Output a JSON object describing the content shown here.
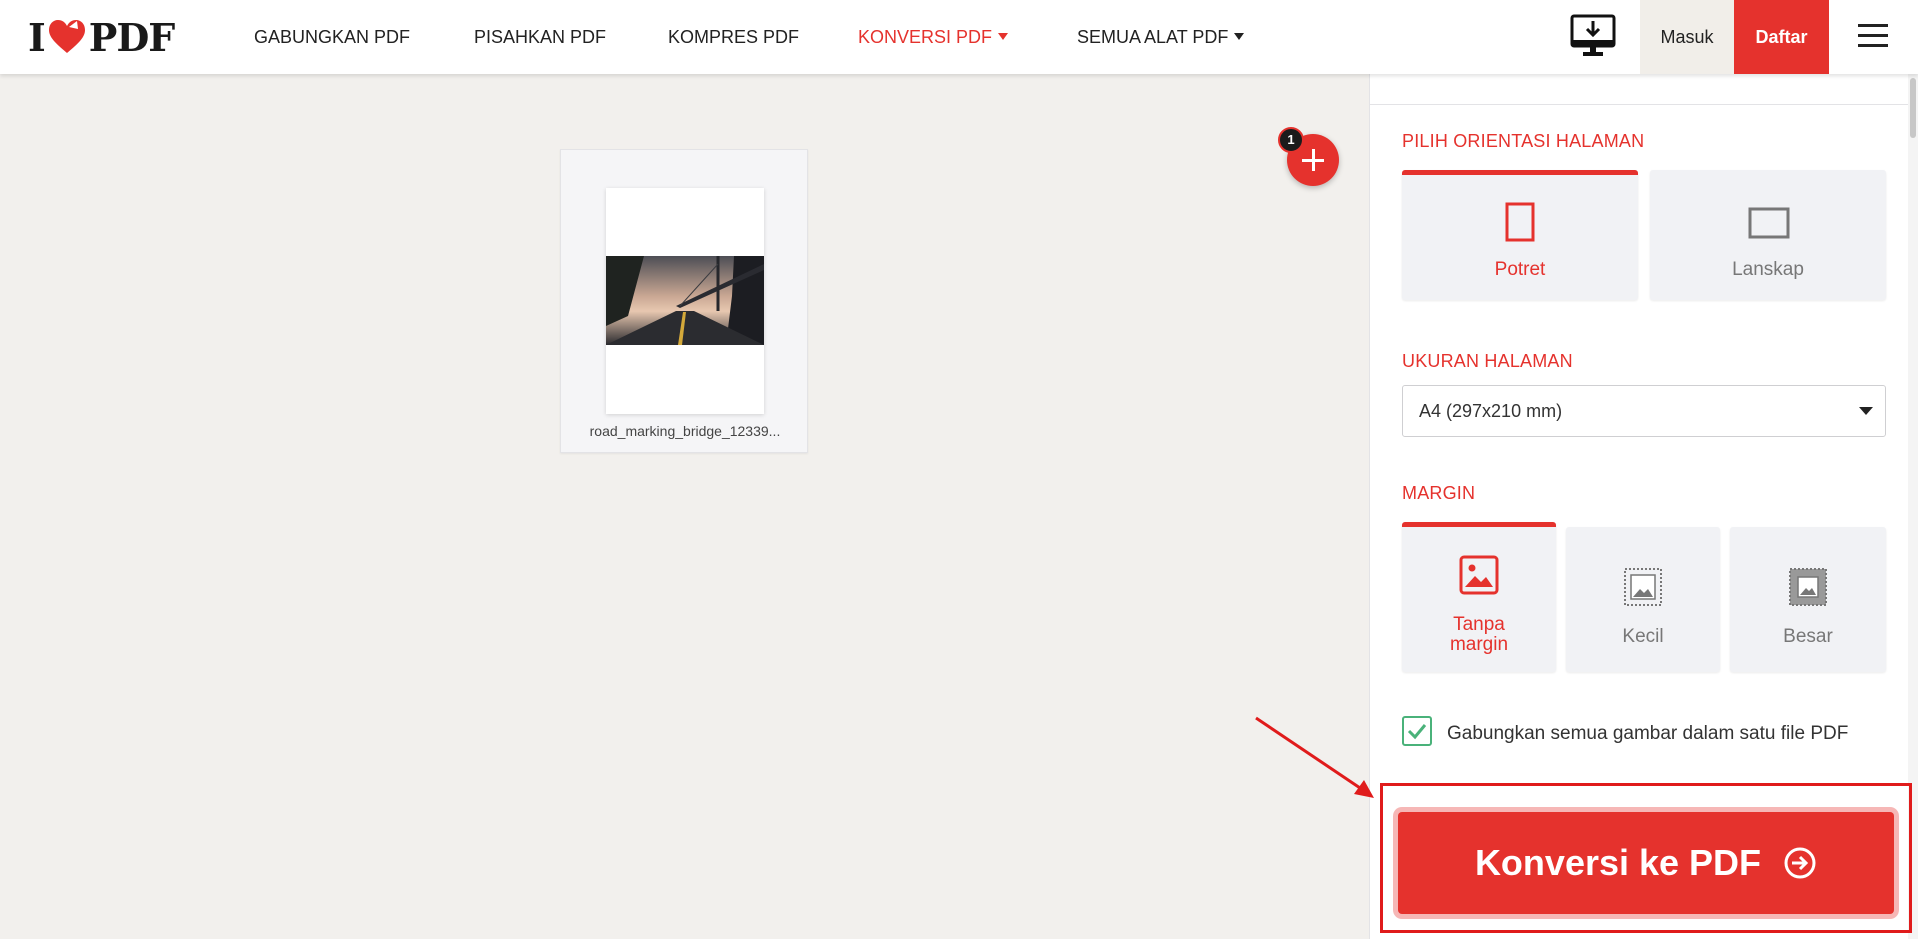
{
  "brand": {
    "left": "I",
    "right": "PDF",
    "colors": {
      "accent": "#e5322d",
      "check": "#4ab27a"
    }
  },
  "nav": {
    "items": [
      {
        "label": "GABUNGKAN PDF"
      },
      {
        "label": "PISAHKAN PDF"
      },
      {
        "label": "KOMPRES PDF"
      },
      {
        "label": "KONVERSI PDF"
      },
      {
        "label": "SEMUA ALAT PDF"
      }
    ],
    "desktop_icon": "desktop-download-icon",
    "login_label": "Masuk",
    "signup_label": "Daftar",
    "menu_icon": "hamburger-menu-icon"
  },
  "workspace": {
    "file_name": "road_marking_bridge_12339...",
    "file_count_badge": "1",
    "add_icon": "plus-icon"
  },
  "sidebar": {
    "orientation": {
      "title": "PILIH ORIENTASI HALAMAN",
      "options": [
        {
          "label": "Potret",
          "icon": "portrait-page-icon",
          "selected": true
        },
        {
          "label": "Lanskap",
          "icon": "landscape-page-icon",
          "selected": false
        }
      ]
    },
    "page_size": {
      "title": "UKURAN HALAMAN",
      "selected": "A4 (297x210 mm)"
    },
    "margin": {
      "title": "MARGIN",
      "options": [
        {
          "label_line1": "Tanpa",
          "label_line2": "margin",
          "icon": "no-margin-image-icon",
          "selected": true
        },
        {
          "label": "Kecil",
          "icon": "small-margin-image-icon",
          "selected": false
        },
        {
          "label": "Besar",
          "icon": "big-margin-image-icon",
          "selected": false
        }
      ]
    },
    "merge": {
      "label": "Gabungkan semua gambar dalam satu file PDF",
      "checked": true
    },
    "convert": {
      "label": "Konversi ke PDF",
      "icon": "arrow-circle-right-icon"
    }
  }
}
